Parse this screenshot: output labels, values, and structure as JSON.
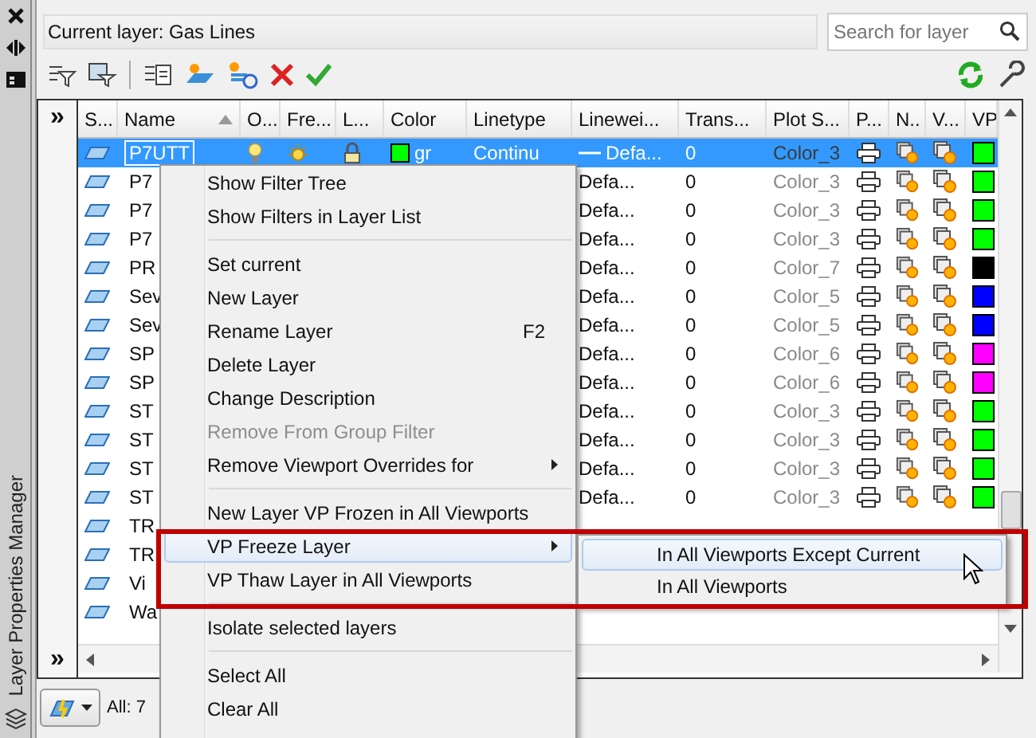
{
  "window": {
    "title": "Layer Properties Manager"
  },
  "current_layer": "Current layer: Gas Lines",
  "search": {
    "placeholder": "Search for layer"
  },
  "filter_pane": {
    "expand_top": "»",
    "expand_bottom": "»"
  },
  "table": {
    "columns": [
      "S...",
      "Name",
      "O...",
      "Fre...",
      "L...",
      "Color",
      "Linetype",
      "Linewei...",
      "Trans...",
      "Plot S...",
      "P...",
      "N..",
      "V...",
      "VP"
    ],
    "rows": [
      {
        "name": "P7UTT",
        "selected": true,
        "swatch": {
          "color": "#00ff00",
          "label": "gr"
        },
        "linetype": "Continu",
        "lineweight": "Defa...",
        "transparency": "0",
        "plot_style": "Color_3",
        "vp": {
          "color": "#00ff00"
        }
      },
      {
        "name": "P7",
        "selected": false,
        "lineweight": "Defa...",
        "transparency": "0",
        "plot_style": "Color_3",
        "vp": {
          "color": "#00ff00"
        }
      },
      {
        "name": "P7",
        "selected": false,
        "lineweight": "Defa...",
        "transparency": "0",
        "plot_style": "Color_3",
        "vp": {
          "color": "#00ff00"
        }
      },
      {
        "name": "P7",
        "selected": false,
        "lineweight": "Defa...",
        "transparency": "0",
        "plot_style": "Color_3",
        "vp": {
          "color": "#00ff00"
        }
      },
      {
        "name": "PR",
        "selected": false,
        "lineweight": "Defa...",
        "transparency": "0",
        "plot_style": "Color_7",
        "vp": {
          "color": "#000000"
        }
      },
      {
        "name": "Sev",
        "selected": false,
        "lineweight": "Defa...",
        "transparency": "0",
        "plot_style": "Color_5",
        "vp": {
          "color": "#0000ff"
        }
      },
      {
        "name": "Sev",
        "selected": false,
        "lineweight": "Defa...",
        "transparency": "0",
        "plot_style": "Color_5",
        "vp": {
          "color": "#0000ff"
        }
      },
      {
        "name": "SP",
        "selected": false,
        "lineweight": "Defa...",
        "transparency": "0",
        "plot_style": "Color_6",
        "vp": {
          "color": "#ff00ff"
        }
      },
      {
        "name": "SP",
        "selected": false,
        "lineweight": "Defa...",
        "transparency": "0",
        "plot_style": "Color_6",
        "vp": {
          "color": "#ff00ff"
        }
      },
      {
        "name": "ST",
        "selected": false,
        "lineweight": "Defa...",
        "transparency": "0",
        "plot_style": "Color_3",
        "vp": {
          "color": "#00ff00"
        }
      },
      {
        "name": "ST",
        "selected": false,
        "lineweight": "Defa...",
        "transparency": "0",
        "plot_style": "Color_3",
        "vp": {
          "color": "#00ff00"
        }
      },
      {
        "name": "ST",
        "selected": false,
        "lineweight": "Defa...",
        "transparency": "0",
        "plot_style": "Color_3",
        "vp": {
          "color": "#00ff00"
        }
      },
      {
        "name": "ST",
        "selected": false,
        "lineweight": "Defa...",
        "transparency": "0",
        "plot_style": "Color_3",
        "vp": {
          "color": "#00ff00"
        }
      },
      {
        "name": "TR",
        "selected": false
      },
      {
        "name": "TR",
        "selected": false
      },
      {
        "name": "Vi",
        "selected": false
      },
      {
        "name": "Wa",
        "selected": false
      }
    ]
  },
  "status": "All: 7",
  "context_menu": {
    "items": [
      {
        "kind": "item",
        "label": "Show Filter Tree",
        "disabled": false,
        "selected": false,
        "has_submenu": false
      },
      {
        "kind": "item",
        "label": "Show Filters in Layer List",
        "disabled": false,
        "selected": false,
        "has_submenu": false
      },
      {
        "kind": "separator"
      },
      {
        "kind": "item",
        "label": "Set current",
        "disabled": false,
        "selected": false,
        "has_submenu": false
      },
      {
        "kind": "item",
        "label": "New Layer",
        "disabled": false,
        "selected": false,
        "has_submenu": false
      },
      {
        "kind": "item",
        "label": "Rename Layer",
        "shortcut": "F2",
        "disabled": false,
        "selected": false,
        "has_submenu": false
      },
      {
        "kind": "item",
        "label": "Delete Layer",
        "disabled": false,
        "selected": false,
        "has_submenu": false
      },
      {
        "kind": "item",
        "label": "Change Description",
        "disabled": false,
        "selected": false,
        "has_submenu": false
      },
      {
        "kind": "item",
        "label": "Remove From Group Filter",
        "disabled": true,
        "selected": false,
        "has_submenu": false
      },
      {
        "kind": "item",
        "label": "Remove Viewport Overrides for",
        "disabled": false,
        "selected": false,
        "has_submenu": true
      },
      {
        "kind": "separator"
      },
      {
        "kind": "item",
        "label": "New Layer VP Frozen in All Viewports",
        "disabled": false,
        "selected": false,
        "has_submenu": false
      },
      {
        "kind": "item",
        "label": "VP Freeze Layer",
        "disabled": false,
        "selected": true,
        "has_submenu": true
      },
      {
        "kind": "item",
        "label": "VP Thaw Layer in All Viewports",
        "disabled": false,
        "selected": false,
        "has_submenu": false
      },
      {
        "kind": "separator"
      },
      {
        "kind": "item",
        "label": "Isolate selected layers",
        "disabled": false,
        "selected": false,
        "has_submenu": false
      },
      {
        "kind": "separator"
      },
      {
        "kind": "item",
        "label": "Select All",
        "disabled": false,
        "selected": false,
        "has_submenu": false
      },
      {
        "kind": "item",
        "label": "Clear All",
        "disabled": false,
        "selected": false,
        "has_submenu": false
      }
    ]
  },
  "submenu": {
    "items": [
      {
        "label": "In All Viewports Except Current",
        "selected": true
      },
      {
        "label": "In All Viewports",
        "selected": false
      }
    ]
  }
}
